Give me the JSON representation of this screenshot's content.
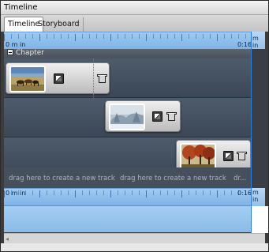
{
  "window": {
    "title": "Timeline"
  },
  "tabs": [
    {
      "label": "Timeline",
      "active": true
    },
    {
      "label": "Storyboard",
      "active": false
    }
  ],
  "ruler_top": {
    "start_label": "0 m in",
    "end_label": "0:16",
    "end_suffix": "m in"
  },
  "chapter": {
    "label": "Chapter"
  },
  "tracks": [
    {
      "clip_thumbnail": "horses-grassland",
      "icons": [
        "transition-icon",
        "effects-icon"
      ]
    },
    {
      "clip_thumbnail": "frosted-trees-lake",
      "icons": [
        "transition-icon",
        "effects-icon"
      ]
    },
    {
      "clip_thumbnail": "autumn-trees-path",
      "icons": [
        "transition-icon",
        "effects-icon"
      ]
    }
  ],
  "drop_hints": [
    "drag here to create a new track",
    "drag here to create a new track",
    "dr..."
  ],
  "ruler_bottom": {
    "start_label": "0 m in",
    "end_label": "0:16",
    "end_suffix": "m in"
  },
  "scrollbar": {
    "left_arrow": "◂"
  },
  "colors": {
    "ruler_blue": "#8fc0ed",
    "track_bg": "#46525f",
    "playhead": "#2f7de1",
    "clip_bg": "#d8d8d8"
  }
}
